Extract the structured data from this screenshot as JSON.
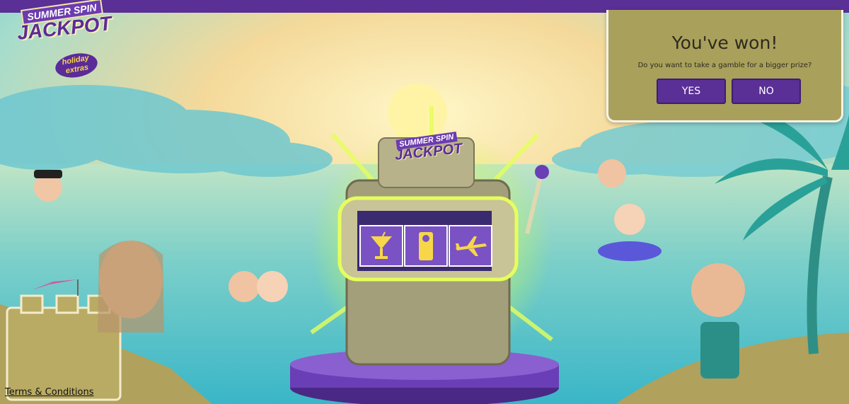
{
  "logo": {
    "line1": "SUMMER SPIN",
    "line2": "JACKPOT",
    "badge": "holiday extras"
  },
  "machine_logo": {
    "line1": "SUMMER SPIN",
    "line2": "JACKPOT"
  },
  "reels": [
    "cocktail-icon",
    "door-hanger-icon",
    "airplane-icon"
  ],
  "dialog": {
    "title": "You've won!",
    "message": "Do you want to take a gamble for a bigger prize?",
    "yes_label": "YES",
    "no_label": "NO"
  },
  "footer": {
    "terms_label": "Terms & Conditions"
  },
  "colors": {
    "brand_purple": "#5a2f96",
    "dialog_bg": "#a9a05c",
    "accent_yellow": "#f7d64a"
  }
}
